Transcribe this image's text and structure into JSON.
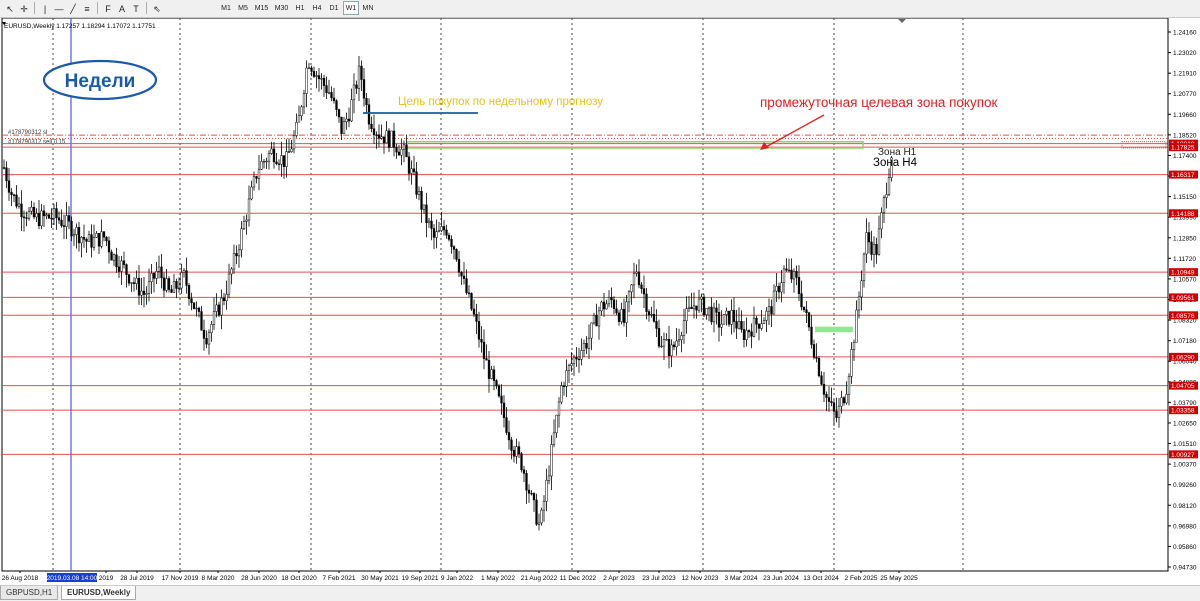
{
  "toolbar": {
    "tools": [
      {
        "name": "cursor-icon",
        "glyph": "↖"
      },
      {
        "name": "crosshair-icon",
        "glyph": "✛"
      },
      {
        "name": "vertical-line-icon",
        "glyph": "|"
      },
      {
        "name": "horizontal-line-icon",
        "glyph": "—"
      },
      {
        "name": "trendline-icon",
        "glyph": "╱"
      },
      {
        "name": "equidistant-channel-icon",
        "glyph": "≡"
      },
      {
        "name": "fibonacci-icon",
        "glyph": "F"
      },
      {
        "name": "text-icon",
        "glyph": "A"
      },
      {
        "name": "text-label-icon",
        "glyph": "T"
      },
      {
        "name": "arrows-icon",
        "glyph": "⇖"
      }
    ],
    "timeframes": [
      "M1",
      "M5",
      "M15",
      "M30",
      "H1",
      "H4",
      "D1",
      "W1",
      "MN"
    ],
    "active_timeframe": "W1"
  },
  "chart": {
    "title": "EURUSD,Weekly  1.17257 1.18294 1.17072 1.17751",
    "badge": "Недели",
    "annotation_target": "Цель покупок по недельному прогнозу",
    "annotation_zone": "промежуточная целевая зона покупок",
    "zone_h1": "Зона H1",
    "zone_h4": "Зона H4",
    "order_line_1": "#178790312 sl",
    "order_line_2": "#178790312 sell 0.15",
    "price_axis": [
      "1.24160",
      "1.23020",
      "1.21910",
      "1.20770",
      "1.19660",
      "1.18520",
      "1.17400",
      "1.16290",
      "1.15150",
      "1.13990",
      "1.12850",
      "1.11720",
      "1.10570",
      "1.09450",
      "1.08320",
      "1.07180",
      "1.06040",
      "1.04880",
      "1.03790",
      "1.02650",
      "1.01510",
      "1.00370",
      "0.99260",
      "0.98120",
      "0.96980",
      "0.95860",
      "0.94730"
    ],
    "date_axis": [
      "26 Aug 2018",
      "2019.03.08 14:00",
      "2019",
      "28 Jul 2019",
      "17 Nov 2019",
      "8 Mar 2020",
      "28 Jun 2020",
      "18 Oct 2020",
      "7 Feb 2021",
      "30 May 2021",
      "19 Sep 2021",
      "9 Jan 2022",
      "1 May 2022",
      "21 Aug 2022",
      "11 Dec 2022",
      "2 Apr 2023",
      "23 Jul 2023",
      "12 Nov 2023",
      "3 Mar 2024",
      "23 Jun 2024",
      "13 Oct 2024",
      "2 Feb 2025",
      "25 May 2025"
    ],
    "levels": [
      {
        "label": "1.18019",
        "price": 1.18019
      },
      {
        "label": "1.17825",
        "price": 1.17825
      },
      {
        "label": "1.16317",
        "price": 1.16317
      },
      {
        "label": "1.14188",
        "price": 1.14188
      },
      {
        "label": "1.10949",
        "price": 1.10949
      },
      {
        "label": "1.09561",
        "price": 1.09561
      },
      {
        "label": "1.08576",
        "price": 1.08576
      },
      {
        "label": "1.06290",
        "price": 1.0629
      },
      {
        "label": "1.04705",
        "price": 1.04705
      },
      {
        "label": "1.03358",
        "price": 1.03358
      },
      {
        "label": "1.00927",
        "price": 1.00927
      }
    ],
    "colors": {
      "level_line": "#e05050",
      "level_tag": "#d00000",
      "badge_border": "#1a5aa8",
      "badge_text": "#1a5aa8",
      "target_text": "#e8c020",
      "target_line": "#1a5aa8",
      "zone_text": "#e02020",
      "zone_rect": "#9bd36a",
      "green_zone": "#90e890",
      "vline": "#5050ff",
      "candle": "#000000"
    }
  },
  "tabs": [
    "GBPUSD,H1",
    "EURUSD,Weekly"
  ],
  "active_tab": "EURUSD,Weekly"
}
